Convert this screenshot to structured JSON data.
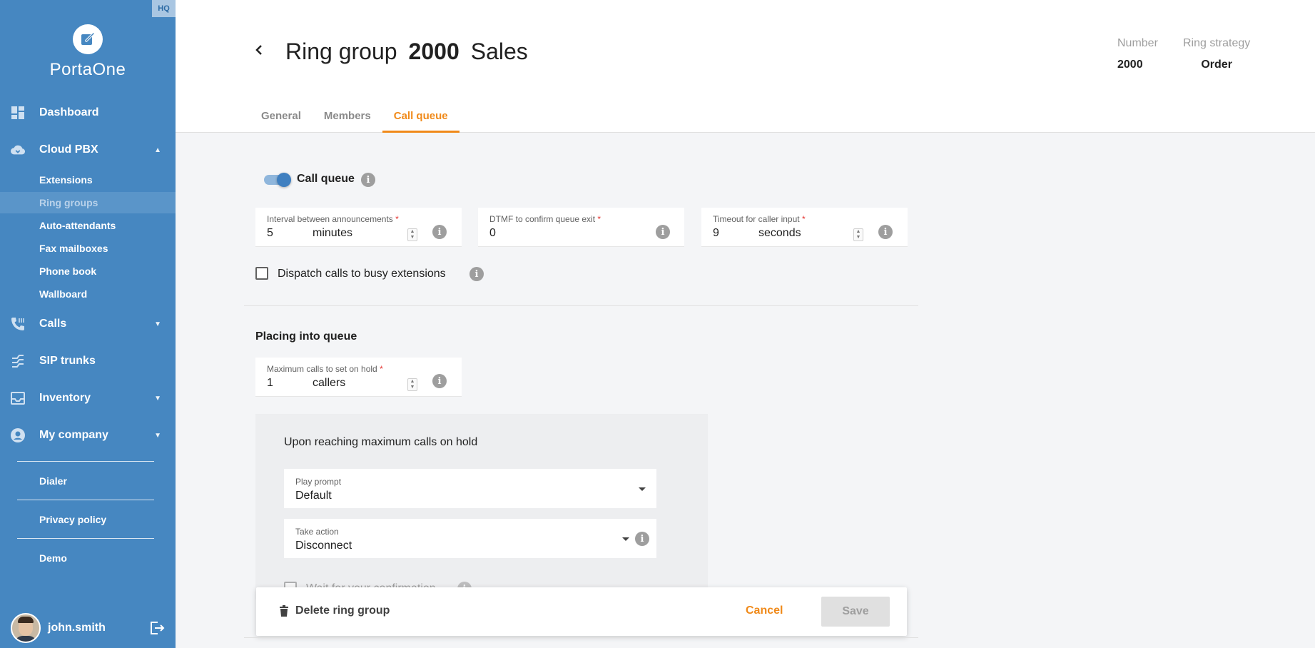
{
  "sidebar": {
    "badge": "HQ",
    "brand": "PortaOne",
    "nav": {
      "dashboard": "Dashboard",
      "cloud_pbx": "Cloud PBX",
      "calls": "Calls",
      "sip_trunks": "SIP trunks",
      "inventory": "Inventory",
      "my_company": "My company"
    },
    "cloud_pbx_items": [
      "Extensions",
      "Ring groups",
      "Auto-attendants",
      "Fax mailboxes",
      "Phone book",
      "Wallboard"
    ],
    "links": {
      "dialer": "Dialer",
      "privacy_policy": "Privacy policy",
      "demo": "Demo"
    },
    "user": {
      "name": "john.smith"
    }
  },
  "header": {
    "title_prefix": "Ring group",
    "title_number": "2000",
    "title_name": "Sales",
    "meta": {
      "number_label": "Number",
      "number_value": "2000",
      "strategy_label": "Ring strategy",
      "strategy_value": "Order"
    },
    "tabs": [
      "General",
      "Members",
      "Call queue"
    ],
    "active_tab": "Call queue"
  },
  "form": {
    "call_queue_label": "Call queue",
    "call_queue_enabled": true,
    "interval": {
      "label": "Interval between announcements",
      "required_mark": "*",
      "value": "5",
      "unit": "minutes"
    },
    "dtmf": {
      "label": "DTMF to confirm queue exit",
      "required_mark": "*",
      "value": "0"
    },
    "timeout": {
      "label": "Timeout for caller input",
      "required_mark": "*",
      "value": "9",
      "unit": "seconds"
    },
    "dispatch_label": "Dispatch calls to busy extensions",
    "dispatch_checked": false,
    "placing_title": "Placing into queue",
    "max_calls": {
      "label": "Maximum calls to set on hold",
      "required_mark": "*",
      "value": "1",
      "unit": "callers"
    },
    "panel_title": "Upon reaching maximum calls on hold",
    "play_prompt": {
      "label": "Play prompt",
      "value": "Default"
    },
    "take_action": {
      "label": "Take action",
      "value": "Disconnect"
    },
    "wait_confirm_label": "Wait for your confirmation"
  },
  "footer": {
    "delete_label": "Delete ring group",
    "cancel_label": "Cancel",
    "save_label": "Save"
  },
  "colors": {
    "sidebar": "#4687c1",
    "accent": "#f08a1a",
    "toggle_on": "#3f7fc0"
  }
}
